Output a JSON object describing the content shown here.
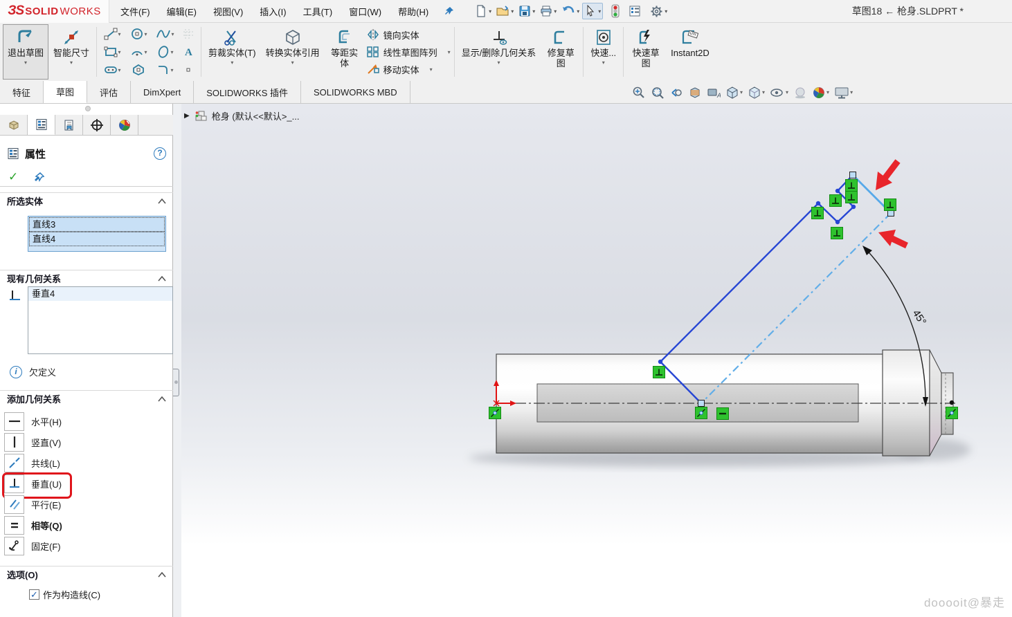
{
  "glyphs": {
    "caret": "▾",
    "flyout_arrow": "▶",
    "check": "✓",
    "help": "?",
    "info": "i",
    "chevron_up": "⌃",
    "checkbox_check": "✓"
  },
  "colors": {
    "sketch_blue": "#2746d4",
    "selected_blue": "#57a9e9",
    "relation_badge_green": "#2ec22e",
    "highlight_red": "#e0151b",
    "logo_red": "#d2232a"
  },
  "titlebar": {
    "document_title": "草图18 ← 枪身.SLDPRT *"
  },
  "menubar": {
    "menus": [
      "文件(F)",
      "编辑(E)",
      "视图(V)",
      "插入(I)",
      "工具(T)",
      "窗口(W)",
      "帮助(H)"
    ]
  },
  "toolbar": {
    "exit_sketch": "退出草图",
    "smart_dimension": "智能尺寸",
    "trim_entities": "剪裁实体(T)",
    "convert_entities": "转换实体引用",
    "offset_entities": "等距实体",
    "mirror_entities": "镜向实体",
    "linear_pattern": "线性草图阵列",
    "move_entities": "移动实体",
    "display_delete_relations": "显示/删除几何关系",
    "repair_sketch": "修复草图",
    "quick_snaps": "快速...",
    "rapid_sketch": "快速草图",
    "instant2d": "Instant2D"
  },
  "ribbon_tabs": {
    "items": [
      {
        "label": "特征",
        "active": false
      },
      {
        "label": "草图",
        "active": true
      },
      {
        "label": "评估",
        "active": false
      },
      {
        "label": "DimXpert",
        "active": false
      },
      {
        "label": "SOLIDWORKS 插件",
        "active": false
      },
      {
        "label": "SOLIDWORKS MBD",
        "active": false
      }
    ]
  },
  "panel": {
    "header": {
      "title": "属性"
    },
    "selected_entities": {
      "title": "所选实体",
      "items": [
        "直线3",
        "直线4"
      ]
    },
    "existing_relations": {
      "title": "现有几何关系",
      "items": [
        "垂直4"
      ],
      "status": "欠定义"
    },
    "add_relations": {
      "title": "添加几何关系",
      "items": [
        {
          "label": "水平(H)",
          "highlighted": false
        },
        {
          "label": "竖直(V)",
          "highlighted": false
        },
        {
          "label": "共线(L)",
          "highlighted": false
        },
        {
          "label": "垂直(U)",
          "highlighted": true
        },
        {
          "label": "平行(E)",
          "highlighted": false
        },
        {
          "label": "相等(Q)",
          "highlighted": false
        },
        {
          "label": "固定(F)",
          "highlighted": false
        }
      ]
    },
    "options": {
      "title": "选项(O)",
      "construction_line_checkbox": {
        "label": "作为构造线(C)",
        "checked": true
      }
    }
  },
  "canvas": {
    "feature_tree_root": "枪身 (默认<<默认>_...",
    "angle_dimension": "45°",
    "watermark": "dooooit@暴走"
  },
  "icons_visible": [
    "new-document",
    "open",
    "save",
    "print",
    "undo",
    "select-cursor",
    "rebuild-traffic-light",
    "task-list",
    "settings-gear",
    "pin",
    "zoom-fit",
    "zoom-area",
    "previous-view",
    "section-view",
    "annotation-view",
    "view-orientation",
    "display-style",
    "hide-show-items",
    "shadow",
    "appearances",
    "view-settings"
  ]
}
